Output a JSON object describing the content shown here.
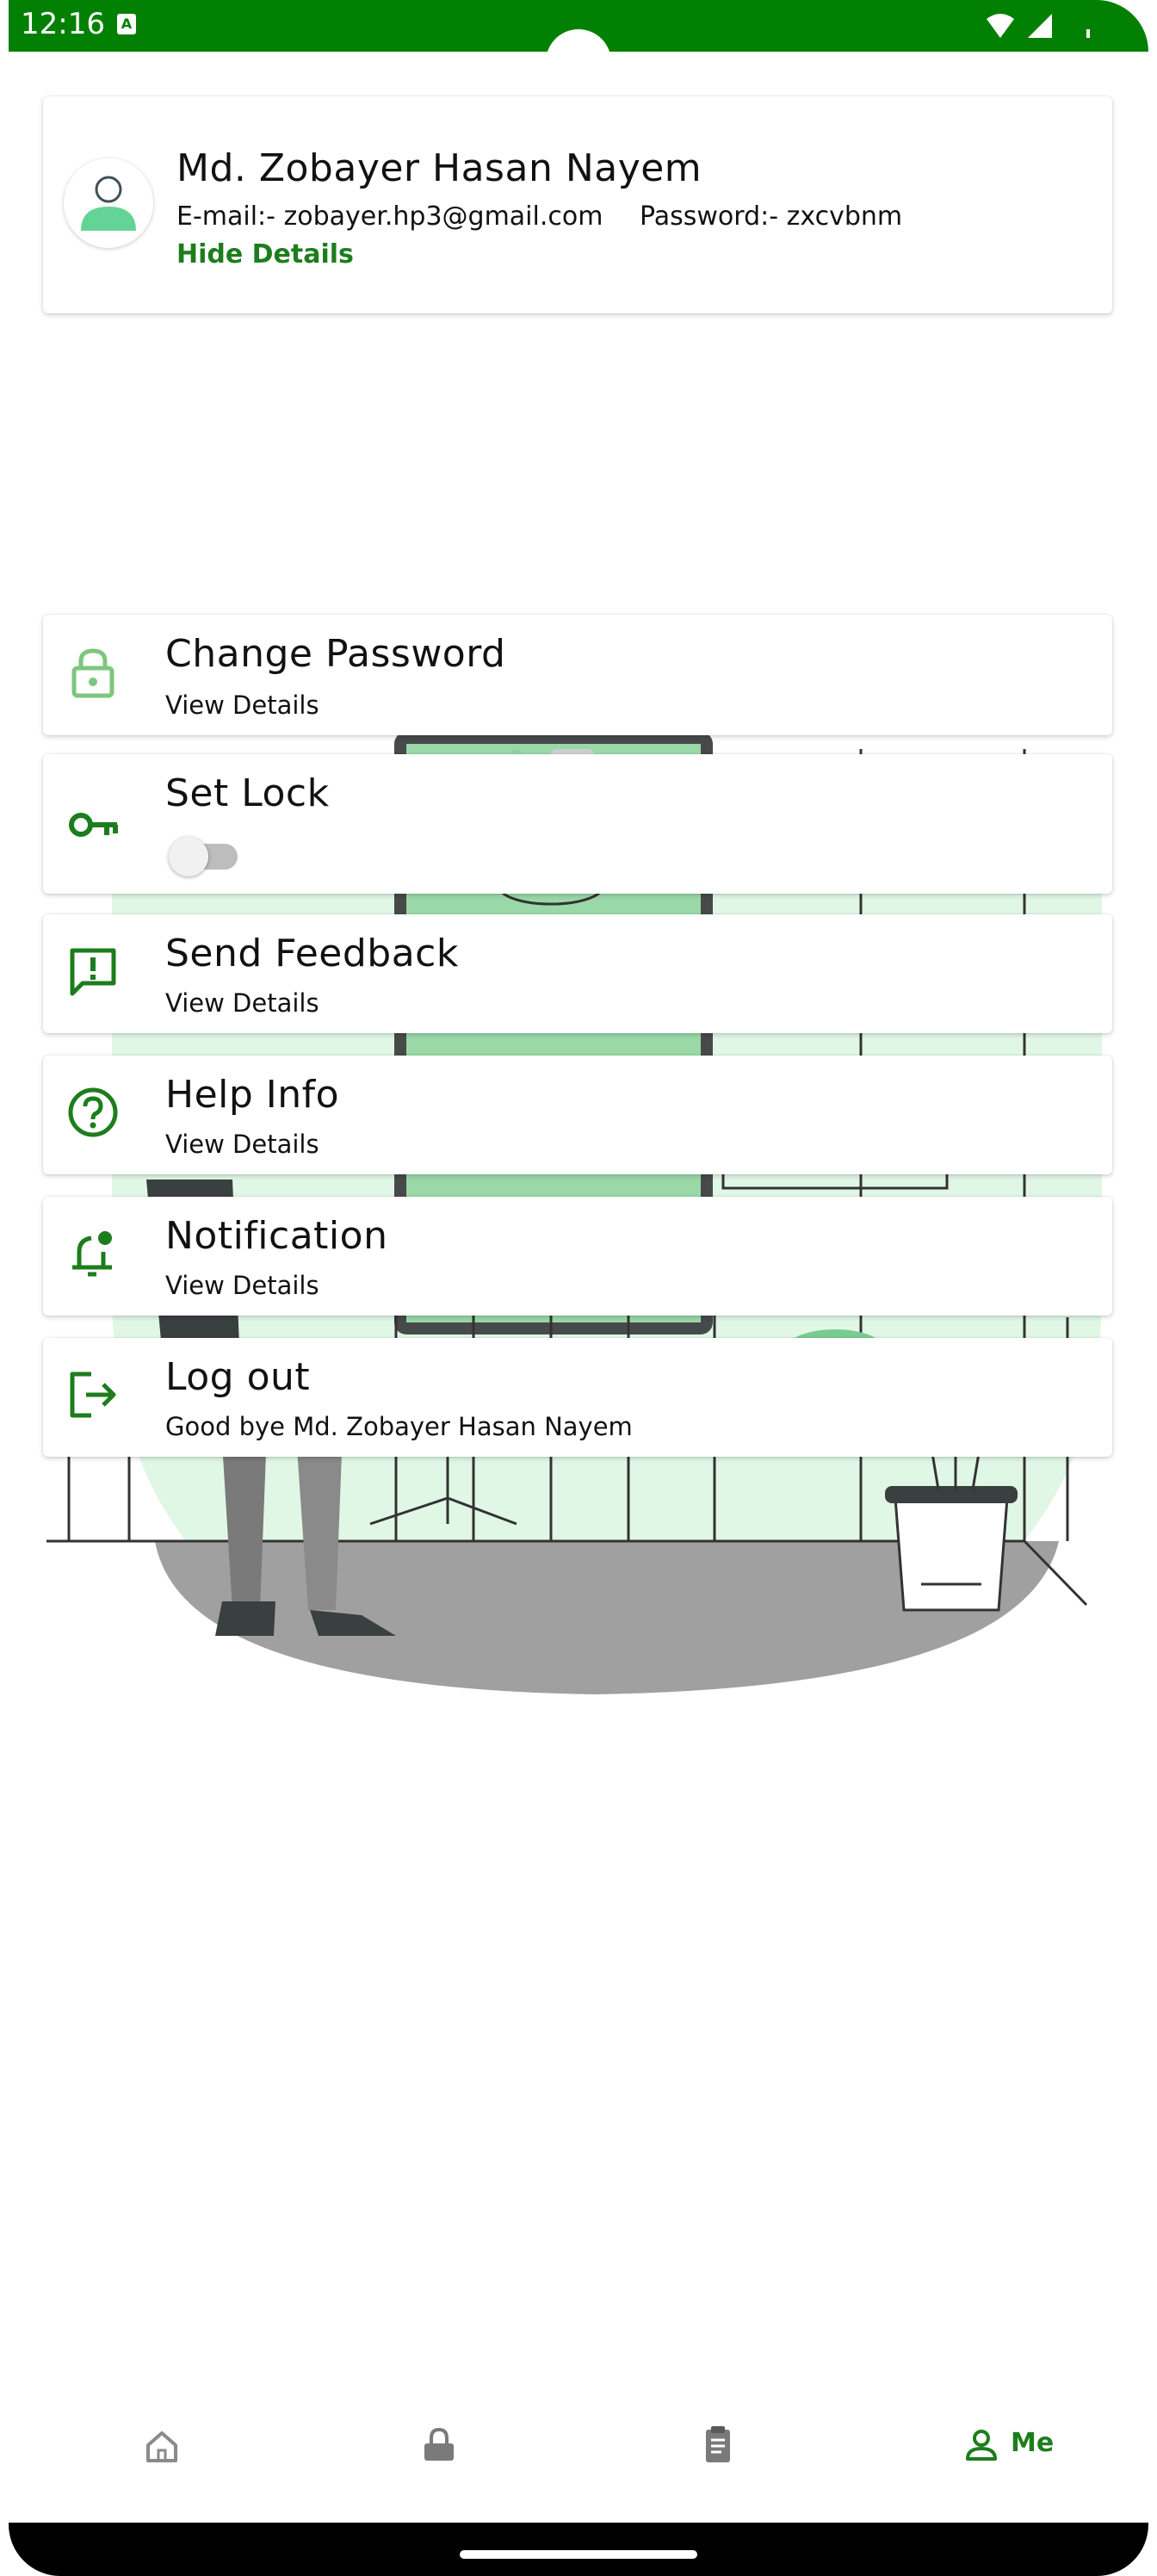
{
  "status_bar": {
    "time": "12:16",
    "notification_badge": "A"
  },
  "profile": {
    "name": "Md. Zobayer Hasan Nayem",
    "email": "E-mail:- zobayer.hp3@gmail.com",
    "password": "Password:- zxcvbnm",
    "toggle_details_label": "Hide Details"
  },
  "menu": {
    "items": [
      {
        "icon": "lock-icon",
        "title": "Change Password",
        "subtitle": "View Details"
      },
      {
        "icon": "key-icon",
        "title": "Set Lock",
        "toggle_on": false
      },
      {
        "icon": "feedback-icon",
        "title": "Send Feedback",
        "subtitle": "View Details"
      },
      {
        "icon": "help-icon",
        "title": "Help Info",
        "subtitle": "View Details"
      },
      {
        "icon": "notification-bell-icon",
        "title": "Notification",
        "subtitle": "View Details"
      },
      {
        "icon": "logout-icon",
        "title": "Log out",
        "subtitle": "Good bye Md. Zobayer Hasan Nayem"
      }
    ]
  },
  "bottom_nav": {
    "items": [
      {
        "icon": "home-icon",
        "label": ""
      },
      {
        "icon": "lock-icon",
        "label": ""
      },
      {
        "icon": "clipboard-icon",
        "label": ""
      },
      {
        "icon": "person-icon",
        "label": "Me",
        "selected": true
      }
    ]
  },
  "colors": {
    "accent": "#1D7D1D",
    "status_bar": "#028004",
    "icon_light_green": "#7DC67D"
  }
}
